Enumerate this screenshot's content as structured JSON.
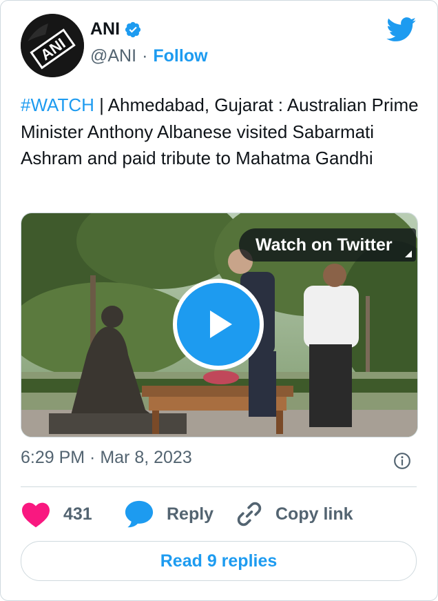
{
  "author": {
    "name": "ANI",
    "handle": "@ANI",
    "follow_label": "Follow",
    "avatar_text": "ANI"
  },
  "tweet": {
    "hashtag": "#WATCH",
    "text": " | Ahmedabad, Gujarat :  Australian Prime Minister Anthony Albanese visited Sabarmati Ashram and paid tribute to Mahatma Gandhi"
  },
  "media": {
    "watch_label": "Watch on Twitter"
  },
  "meta": {
    "timestamp": "6:29 PM · Mar 8, 2023"
  },
  "actions": {
    "like_count": "431",
    "reply_label": "Reply",
    "copy_link_label": "Copy link"
  },
  "read_replies_label": "Read 9 replies",
  "colors": {
    "accent": "#1d9bf0",
    "like": "#f91880",
    "muted": "#536471"
  }
}
